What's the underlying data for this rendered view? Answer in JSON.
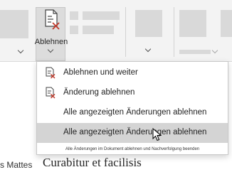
{
  "ribbon": {
    "ablehnen_label": "Ablehnen"
  },
  "menu": {
    "items": [
      {
        "label": "Ablehnen und weiter",
        "icon": "reject-change-icon"
      },
      {
        "label": "Änderung ablehnen",
        "icon": "reject-change-icon"
      },
      {
        "label": "Alle angezeigten Änderungen ablehnen",
        "icon": ""
      },
      {
        "label": "Alle angezeigten Änderungen ablehnen",
        "icon": ""
      }
    ],
    "footer_note": "Alle Änderungen im Dokument ablehnen und Nachverfolgung beenden"
  },
  "document": {
    "author_fragment": "s Mattes",
    "body_fragment": "Curabitur et facilisis"
  },
  "colors": {
    "reject_red": "#c0392b",
    "hover_bg": "#d4d4d4",
    "ribbon_bg": "#f3f3f3"
  }
}
